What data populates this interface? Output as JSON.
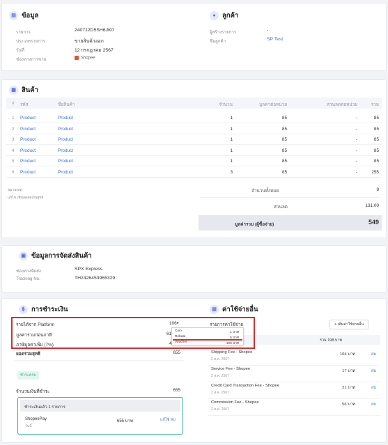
{
  "info": {
    "title": "ข้อมูล",
    "rows": [
      {
        "label": "รายการ",
        "value": "240712D5SH6JK0"
      },
      {
        "label": "ประเภทรายการ",
        "value": "ขายสินค้าออก"
      },
      {
        "label": "วันที่",
        "value": "12 กรกฎาคม 2567"
      },
      {
        "label": "ช่องทางการขาย",
        "value": "Shopee"
      }
    ]
  },
  "customer": {
    "title": "ลูกค้า",
    "rows": [
      {
        "label": "ผู้สร้างรายการ",
        "value": "-"
      },
      {
        "label": "ชื่อลูกค้า",
        "value": "SP Test"
      }
    ]
  },
  "products": {
    "title": "สินค้า",
    "headers": [
      "#",
      "รหัส",
      "ชื่อสินค้า",
      "จำนวน",
      "มูลค่าต่อหน่วย",
      "ส่วนลดต่อหน่วย",
      "รวม"
    ],
    "rows": [
      {
        "n": "1",
        "code": "Product",
        "name": "Product",
        "qty": "1",
        "unit": "85",
        "disc": "-",
        "total": "85"
      },
      {
        "n": "2",
        "code": "Product",
        "name": "Product",
        "qty": "1",
        "unit": "85",
        "disc": "-",
        "total": "85"
      },
      {
        "n": "3",
        "code": "Product",
        "name": "Product",
        "qty": "1",
        "unit": "85",
        "disc": "-",
        "total": "85"
      },
      {
        "n": "4",
        "code": "Product",
        "name": "Product",
        "qty": "1",
        "unit": "85",
        "disc": "-",
        "total": "85"
      },
      {
        "n": "5",
        "code": "Product",
        "name": "Product",
        "qty": "1",
        "unit": "85",
        "disc": "-",
        "total": "85"
      },
      {
        "n": "6",
        "code": "Product",
        "name": "Product",
        "qty": "3",
        "unit": "85",
        "disc": "-",
        "total": "255"
      }
    ],
    "note_label": "หมายเหตุ",
    "note_sub": "แก้ไข เพิ่มลดลดเงินสุทธิ",
    "total_qty_label": "จำนวนทั้งหมด",
    "total_qty": "8",
    "discount_label": "ส่วนลด",
    "discount": "131.00",
    "grand_label": "มูลค่ารวม (ผู้ซื้อจ่าย)",
    "grand": "549"
  },
  "shipping": {
    "title": "ข้อมูลการจัดส่งสินค้า",
    "rows": [
      {
        "label": "ช่องทางจัดส่ง",
        "value": "SPX Express"
      },
      {
        "label": "Tracking No.",
        "value": "TH2426453965329"
      }
    ]
  },
  "payment": {
    "title": "การชำระเงิน",
    "rows": [
      {
        "label": "รายได้จาก Platform",
        "value": "106"
      },
      {
        "label": "มูลค่ารวมก่อนภาษี",
        "value": "61"
      },
      {
        "label": "ภาษีมูลค่าเพิ่ม (7%)",
        "value": "4"
      }
    ],
    "net_label": "ยอดรวมสุทธิ",
    "net": "655",
    "status_badge": "ชำระครบ",
    "paid_label": "จำนวนเงินที่ชำระ",
    "paid": "655",
    "paid_box_title": "ชำระเงินแล้ว 1 รายการ",
    "method": "ShopeePay",
    "method_sub": "วันนี้",
    "method_amount": "655 บาท",
    "edit": "แก้ไข",
    "delete": "ลบ"
  },
  "tooltip": {
    "rows": [
      {
        "label": "Coin",
        "value": "1 บาท"
      },
      {
        "label": "Rebate",
        "value": "5 บาท"
      },
      {
        "label": "Voucher",
        "value": "100 บาท"
      }
    ]
  },
  "expenses": {
    "title": "ค่าใช้จ่ายอื่น",
    "header": "รายการค่าใช้จ่าย",
    "add_button": "+ เพิ่มค่าใช้จ่ายอื่น",
    "total_label": "รวม 198 บาท",
    "items": [
      {
        "name": "Shipping Fee - Shopee",
        "date": "2 ส.ค. 2567",
        "amount": "104 บาท",
        "action": "ลบ"
      },
      {
        "name": "Service Fee - Shopee",
        "date": "2 ส.ค. 2567",
        "amount": "17 บาท",
        "action": "ลบ"
      },
      {
        "name": "Credit Card Transaction Fee - Shopee",
        "date": "2 ส.ค. 2567",
        "amount": "21 บาท",
        "action": "ลบ"
      },
      {
        "name": "Commission Fee - Shopee",
        "date": "2 ส.ค. 2567",
        "amount": "56 บาท",
        "action": "ลบ"
      }
    ]
  },
  "colors": {
    "accent": "#3a6fd8",
    "highlight": "#d92b2b",
    "success": "#2bb58c"
  }
}
